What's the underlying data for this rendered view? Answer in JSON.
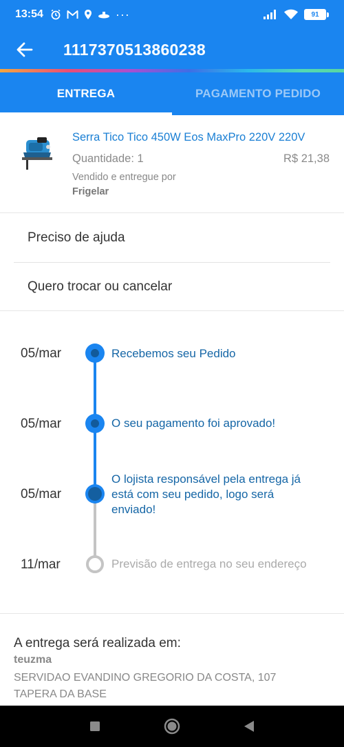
{
  "status_bar": {
    "time": "13:54",
    "battery": "91"
  },
  "app_bar": {
    "title": "1117370513860238"
  },
  "tabs": [
    {
      "label": "ENTREGA",
      "active": true
    },
    {
      "label": "PAGAMENTO PEDIDO",
      "active": false
    }
  ],
  "product": {
    "name": "Serra Tico Tico 450W Eos MaxPro 220V 220V",
    "quantity": "Quantidade: 1",
    "price": "R$ 21,38",
    "seller_label": "Vendido e entregue por",
    "seller": "Frigelar"
  },
  "help": {
    "need_help": "Preciso de ajuda",
    "exchange_cancel": "Quero trocar ou cancelar"
  },
  "timeline": [
    {
      "date": "05/mar",
      "text": "Recebemos seu Pedido",
      "status": "done"
    },
    {
      "date": "05/mar",
      "text": "O seu pagamento foi aprovado!",
      "status": "done"
    },
    {
      "date": "05/mar",
      "text": "O lojista responsável pela entrega já está com seu pedido, logo será enviado!",
      "status": "current"
    },
    {
      "date": "11/mar",
      "text": "Previsão de entrega no seu endereço",
      "status": "pending"
    }
  ],
  "delivery": {
    "title": "A entrega será realizada em:",
    "name": "teuzma",
    "address": "SERVIDAO EVANDINO GREGORIO DA COSTA, 107",
    "district": "TAPERA DA BASE"
  },
  "colors": {
    "primary": "#1a85f0",
    "link": "#1a7fd4",
    "timeline_text": "#1566a6"
  }
}
